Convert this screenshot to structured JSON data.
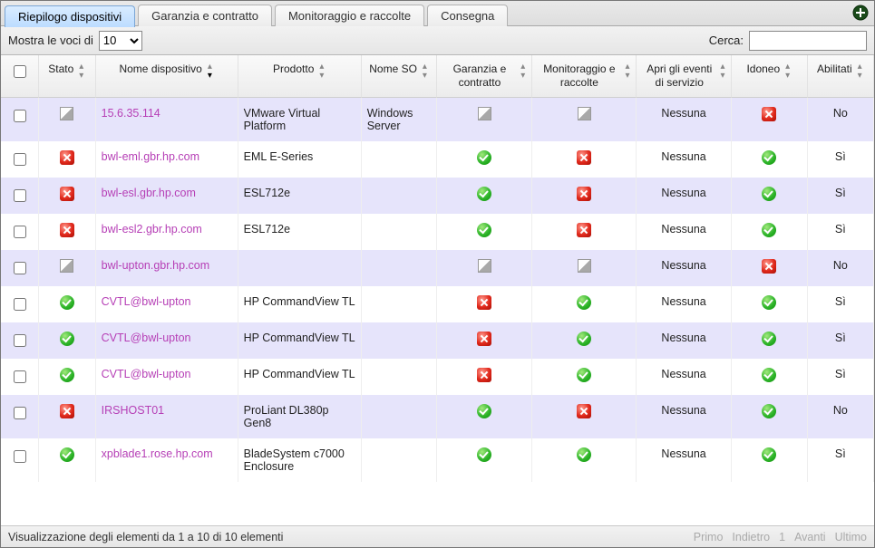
{
  "tabs": [
    "Riepilogo dispositivi",
    "Garanzia e contratto",
    "Monitoraggio e raccolte",
    "Consegna"
  ],
  "active_tab": 0,
  "toolbar": {
    "entries_prefix": "Mostra le voci di",
    "entries_value": "10",
    "search_label": "Cerca:",
    "search_value": ""
  },
  "columns": {
    "checkbox": "",
    "stato": "Stato",
    "nome_dispositivo": "Nome dispositivo",
    "prodotto": "Prodotto",
    "nome_so": "Nome SO",
    "garanzia": "Garanzia e contratto",
    "monitoraggio": "Monitoraggio e raccolte",
    "apri_eventi": "Apri gli eventi di servizio",
    "idoneo": "Idoneo",
    "abilitati": "Abilitati"
  },
  "rows": [
    {
      "stato": "unk",
      "nome": "15.6.35.114",
      "prodotto": "VMware Virtual Platform",
      "so": "Windows Server",
      "garanzia": "unk",
      "monitor": "unk",
      "eventi": "Nessuna",
      "idoneo": "err",
      "abilitati": "No"
    },
    {
      "stato": "err",
      "nome": "bwl-eml.gbr.hp.com",
      "prodotto": "EML E-Series",
      "so": "",
      "garanzia": "ok",
      "monitor": "err",
      "eventi": "Nessuna",
      "idoneo": "ok",
      "abilitati": "Sì"
    },
    {
      "stato": "err",
      "nome": "bwl-esl.gbr.hp.com",
      "prodotto": "ESL712e",
      "so": "",
      "garanzia": "ok",
      "monitor": "err",
      "eventi": "Nessuna",
      "idoneo": "ok",
      "abilitati": "Sì"
    },
    {
      "stato": "err",
      "nome": "bwl-esl2.gbr.hp.com",
      "prodotto": "ESL712e",
      "so": "",
      "garanzia": "ok",
      "monitor": "err",
      "eventi": "Nessuna",
      "idoneo": "ok",
      "abilitati": "Sì"
    },
    {
      "stato": "unk",
      "nome": "bwl-upton.gbr.hp.com",
      "prodotto": "",
      "so": "",
      "garanzia": "unk",
      "monitor": "unk",
      "eventi": "Nessuna",
      "idoneo": "err",
      "abilitati": "No"
    },
    {
      "stato": "ok",
      "nome": "CVTL@bwl-upton",
      "prodotto": "HP CommandView TL",
      "so": "",
      "garanzia": "err",
      "monitor": "ok",
      "eventi": "Nessuna",
      "idoneo": "ok",
      "abilitati": "Sì"
    },
    {
      "stato": "ok",
      "nome": "CVTL@bwl-upton",
      "prodotto": "HP CommandView TL",
      "so": "",
      "garanzia": "err",
      "monitor": "ok",
      "eventi": "Nessuna",
      "idoneo": "ok",
      "abilitati": "Sì"
    },
    {
      "stato": "ok",
      "nome": "CVTL@bwl-upton",
      "prodotto": "HP CommandView TL",
      "so": "",
      "garanzia": "err",
      "monitor": "ok",
      "eventi": "Nessuna",
      "idoneo": "ok",
      "abilitati": "Sì"
    },
    {
      "stato": "err",
      "nome": "IRSHOST01",
      "prodotto": "ProLiant DL380p Gen8",
      "so": "",
      "garanzia": "ok",
      "monitor": "err",
      "eventi": "Nessuna",
      "idoneo": "ok",
      "abilitati": "No"
    },
    {
      "stato": "ok",
      "nome": "xpblade1.rose.hp.com",
      "prodotto": "BladeSystem c7000 Enclosure",
      "so": "",
      "garanzia": "ok",
      "monitor": "ok",
      "eventi": "Nessuna",
      "idoneo": "ok",
      "abilitati": "Sì"
    }
  ],
  "footer": {
    "info": "Visualizzazione degli elementi da 1 a 10 di 10 elementi",
    "pager": {
      "primo": "Primo",
      "indietro": "Indietro",
      "page": "1",
      "avanti": "Avanti",
      "ultimo": "Ultimo"
    }
  }
}
